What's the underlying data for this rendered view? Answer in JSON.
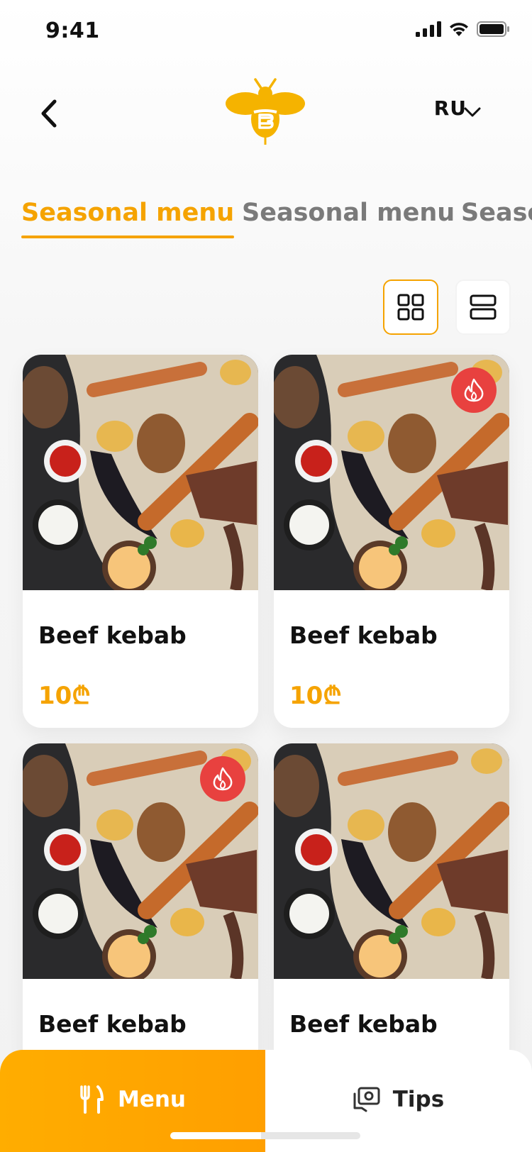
{
  "status_bar": {
    "time": "9:41"
  },
  "header": {
    "language": "RU"
  },
  "tabs": [
    {
      "label": "Seasonal menu",
      "active": true
    },
    {
      "label": "Seasonal menu",
      "active": false
    },
    {
      "label": "Seasonal menu",
      "active": false
    }
  ],
  "view_mode": "grid",
  "products": [
    {
      "name": "Beef kebab",
      "price": "10₾",
      "hot": false
    },
    {
      "name": "Beef kebab",
      "price": "10₾",
      "hot": true
    },
    {
      "name": "Beef kebab",
      "price": "",
      "hot": true
    },
    {
      "name": "Beef kebab",
      "price": "",
      "hot": false
    }
  ],
  "bottom_nav": {
    "menu_label": "Menu",
    "tips_label": "Tips"
  },
  "colors": {
    "accent": "#f5a300",
    "hot_badge": "#e8413f",
    "bottom_gradient_start": "#ffad00",
    "bottom_gradient_end": "#ff9f00"
  },
  "icons": [
    "back-icon",
    "bee-logo",
    "chevron-down-icon",
    "grid-view-icon",
    "list-view-icon",
    "flame-icon",
    "fork-knife-icon",
    "tips-icon"
  ]
}
